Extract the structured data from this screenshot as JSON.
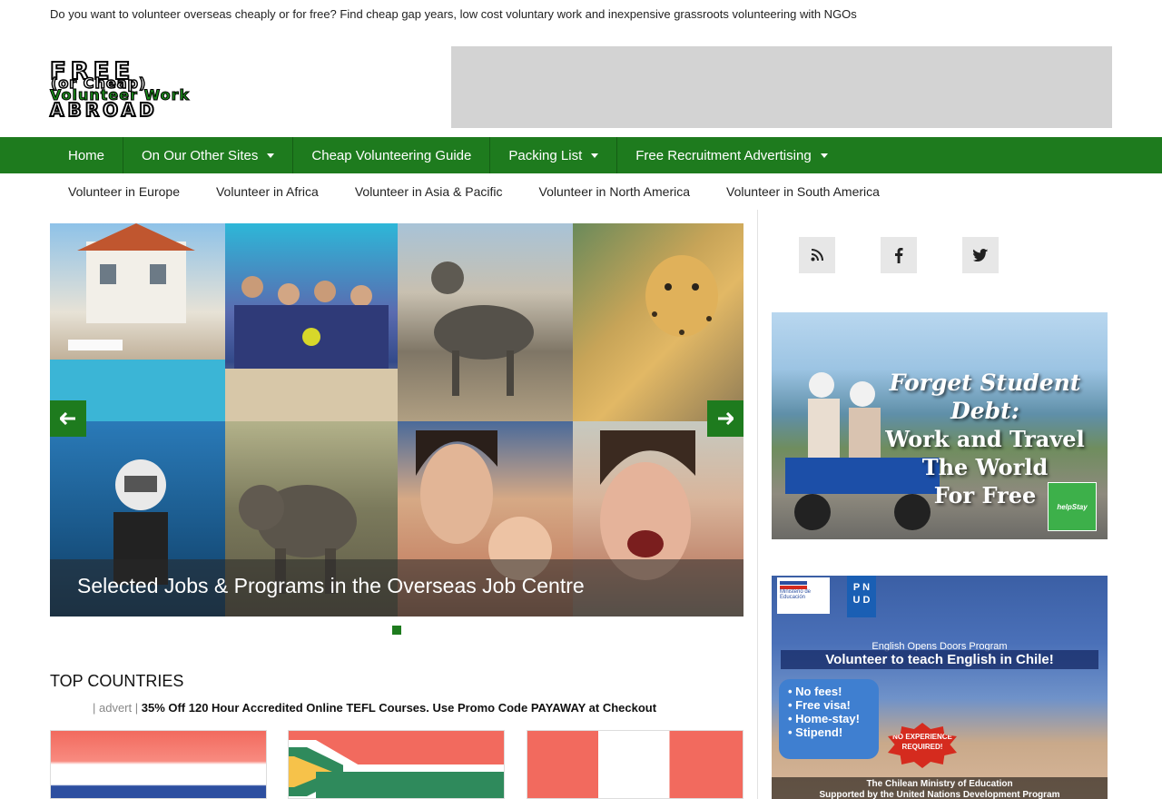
{
  "tagline": "Do you want to volunteer overseas cheaply or for free? Find cheap gap years, low cost voluntary work and inexpensive grassroots volunteering with NGOs",
  "logo": {
    "line1": "FREE",
    "line2": "(or Cheap)",
    "line3": "Volunteer Work",
    "line4": "ABROAD"
  },
  "main_nav": [
    {
      "label": "Home",
      "has_dropdown": false
    },
    {
      "label": "On Our Other Sites",
      "has_dropdown": true
    },
    {
      "label": "Cheap Volunteering Guide",
      "has_dropdown": false
    },
    {
      "label": "Packing List",
      "has_dropdown": true
    },
    {
      "label": "Free Recruitment Advertising",
      "has_dropdown": true
    }
  ],
  "sub_nav": [
    "Volunteer in Europe",
    "Volunteer in Africa",
    "Volunteer in Asia & Pacific",
    "Volunteer in North America",
    "Volunteer in South America"
  ],
  "slider": {
    "caption": "Selected Jobs & Programs in the Overseas Job Centre",
    "slide_count": 1,
    "active_slide": 1
  },
  "top_countries": {
    "title": "TOP COUNTRIES",
    "advert_tag": "| advert |",
    "advert_text": "35% Off 120 Hour Accredited Online TEFL Courses. Use Promo Code PAYAWAY at Checkout"
  },
  "social": [
    {
      "icon": "rss-icon"
    },
    {
      "icon": "facebook-icon"
    },
    {
      "icon": "twitter-icon"
    }
  ],
  "sidebar_ad1": {
    "line1": "Forget Student Debt:",
    "line2": "Work and Travel",
    "line3": "The World",
    "line4": "For Free",
    "badge": "helpStay"
  },
  "sidebar_ad2": {
    "logo_chile": "Ministerio de Educación",
    "logo_undp_1": "P N",
    "logo_undp_2": "U D",
    "program": "English Opens Doors Program",
    "headline": "Volunteer to teach English in Chile!",
    "bullets": [
      "• No fees!",
      "• Free visa!",
      "• Home-stay!",
      "• Stipend!"
    ],
    "starburst": "NO EXPERIENCE REQUIRED!",
    "footer1": "The Chilean Ministry of Education",
    "footer2": "Supported by the United Nations Development Program"
  },
  "colors": {
    "brand_green": "#1e7b1e",
    "ad_placeholder": "#d3d3d3"
  }
}
